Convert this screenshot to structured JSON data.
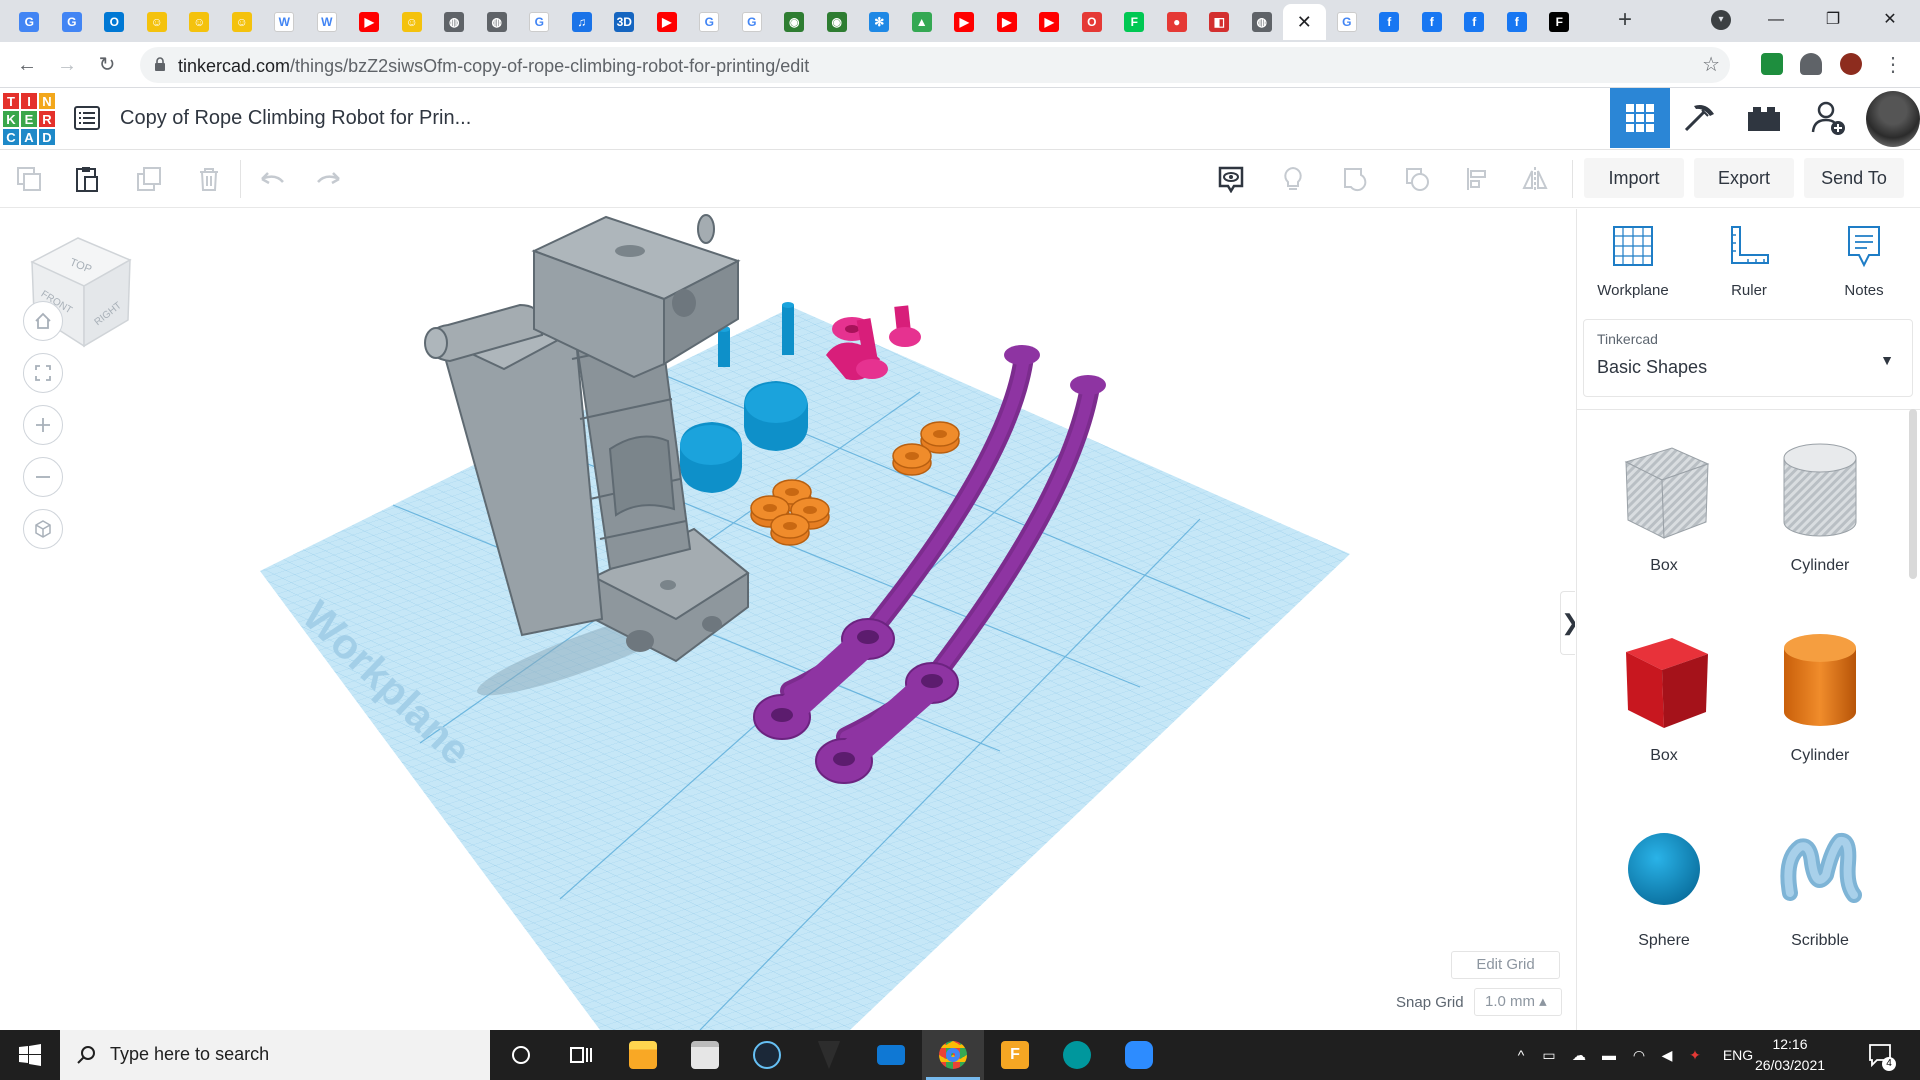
{
  "browser": {
    "tabs": [
      {
        "icon": "google-translate-icon",
        "color": "#4285f4",
        "glyph": "G"
      },
      {
        "icon": "google-translate-icon",
        "color": "#4285f4",
        "glyph": "G"
      },
      {
        "icon": "outlook-icon",
        "color": "#0078d4",
        "glyph": "O"
      },
      {
        "icon": "homer-icon",
        "color": "#f4c20d",
        "glyph": "☺"
      },
      {
        "icon": "homer-icon",
        "color": "#f4c20d",
        "glyph": "☺"
      },
      {
        "icon": "homer-icon",
        "color": "#f4c20d",
        "glyph": "☺"
      },
      {
        "icon": "wikipedia-icon",
        "color": "#ffffff",
        "glyph": "W"
      },
      {
        "icon": "wikipedia-icon",
        "color": "#ffffff",
        "glyph": "W"
      },
      {
        "icon": "youtube-icon",
        "color": "#ff0000",
        "glyph": "▶"
      },
      {
        "icon": "homer-icon",
        "color": "#f4c20d",
        "glyph": "☺"
      },
      {
        "icon": "globe-icon",
        "color": "#5f6368",
        "glyph": "◍"
      },
      {
        "icon": "globe-icon",
        "color": "#5f6368",
        "glyph": "◍"
      },
      {
        "icon": "google-icon",
        "color": "#ffffff",
        "glyph": "G"
      },
      {
        "icon": "audio-icon",
        "color": "#1a73e8",
        "glyph": "♫"
      },
      {
        "icon": "3d-icon",
        "color": "#1565c0",
        "glyph": "3D"
      },
      {
        "icon": "youtube-icon",
        "color": "#ff0000",
        "glyph": "▶"
      },
      {
        "icon": "google-icon",
        "color": "#ffffff",
        "glyph": "G"
      },
      {
        "icon": "google-icon",
        "color": "#ffffff",
        "glyph": "G"
      },
      {
        "icon": "seal-icon",
        "color": "#2e7d32",
        "glyph": "◉"
      },
      {
        "icon": "seal-icon",
        "color": "#2e7d32",
        "glyph": "◉"
      },
      {
        "icon": "snowflake-icon",
        "color": "#1e88e5",
        "glyph": "✻"
      },
      {
        "icon": "google-drive-icon",
        "color": "#34a853",
        "glyph": "▲"
      },
      {
        "icon": "youtube-icon",
        "color": "#ff0000",
        "glyph": "▶"
      },
      {
        "icon": "youtube-icon",
        "color": "#ff0000",
        "glyph": "▶"
      },
      {
        "icon": "youtube-icon",
        "color": "#ff0000",
        "glyph": "▶"
      },
      {
        "icon": "opera-icon",
        "color": "#e53935",
        "glyph": "O"
      },
      {
        "icon": "f-icon",
        "color": "#00c853",
        "glyph": "F"
      },
      {
        "icon": "tomato-icon",
        "color": "#e53935",
        "glyph": "●"
      },
      {
        "icon": "app-icon",
        "color": "#d32f2f",
        "glyph": "◧"
      },
      {
        "icon": "globe-icon",
        "color": "#5f6368",
        "glyph": "◍"
      },
      {
        "icon": "close-icon",
        "color": "#ffffff",
        "glyph": "✕",
        "active": true
      },
      {
        "icon": "google-icon",
        "color": "#ffffff",
        "glyph": "G"
      },
      {
        "icon": "facebook-icon",
        "color": "#1877f2",
        "glyph": "f"
      },
      {
        "icon": "facebook-icon",
        "color": "#1877f2",
        "glyph": "f"
      },
      {
        "icon": "facebook-icon",
        "color": "#1877f2",
        "glyph": "f"
      },
      {
        "icon": "facebook-icon",
        "color": "#1877f2",
        "glyph": "f"
      },
      {
        "icon": "f-icon",
        "color": "#000000",
        "glyph": "F"
      }
    ],
    "new_tab_glyph": "+",
    "window": {
      "minimize": "—",
      "maximize": "❐",
      "close": "✕"
    },
    "nav": {
      "back": "←",
      "forward": "→",
      "reload": "↻"
    },
    "url_host": "tinkercad.com",
    "url_path": "/things/bzZ2siwsOfm-copy-of-rope-climbing-robot-for-printing/edit",
    "bookmark_glyph": "☆",
    "menu_glyph": "⋮"
  },
  "tinkercad": {
    "logo_letters": [
      "T",
      "I",
      "N",
      "K",
      "E",
      "R",
      "C",
      "A",
      "D"
    ],
    "logo_colors": [
      "#e4312b",
      "#e4312b",
      "#f2a71b",
      "#3aa74b",
      "#3aa74b",
      "#e4312b",
      "#1e89c8",
      "#1e89c8",
      "#1e89c8"
    ],
    "design_title": "Copy of Rope Climbing Robot for Prin...",
    "actions": {
      "import": "Import",
      "export": "Export",
      "send_to": "Send To"
    },
    "workplane_label": "Workplane",
    "viewcube": {
      "top": "TOP",
      "front": "FRONT",
      "right": "RIGHT"
    },
    "grid": {
      "edit_grid": "Edit Grid",
      "snap_grid_label": "Snap Grid",
      "snap_grid_value": "1.0 mm ▴"
    },
    "collapse_glyph": "❯",
    "panel": {
      "tools": [
        {
          "label": "Workplane",
          "icon": "workplane-icon"
        },
        {
          "label": "Ruler",
          "icon": "ruler-icon"
        },
        {
          "label": "Notes",
          "icon": "notes-icon"
        }
      ],
      "library_source": "Tinkercad",
      "library_name": "Basic Shapes",
      "shapes": [
        {
          "label": "Box",
          "icon": "box-hole-icon"
        },
        {
          "label": "Cylinder",
          "icon": "cylinder-hole-icon"
        },
        {
          "label": "Box",
          "icon": "box-icon"
        },
        {
          "label": "Cylinder",
          "icon": "cylinder-icon"
        },
        {
          "label": "Sphere",
          "icon": "sphere-icon"
        },
        {
          "label": "Scribble",
          "icon": "scribble-icon"
        }
      ]
    }
  },
  "taskbar": {
    "search_placeholder": "Type here to search",
    "language": "ENG",
    "time": "12:16",
    "date": "26/03/2021",
    "notification_count": "4"
  }
}
